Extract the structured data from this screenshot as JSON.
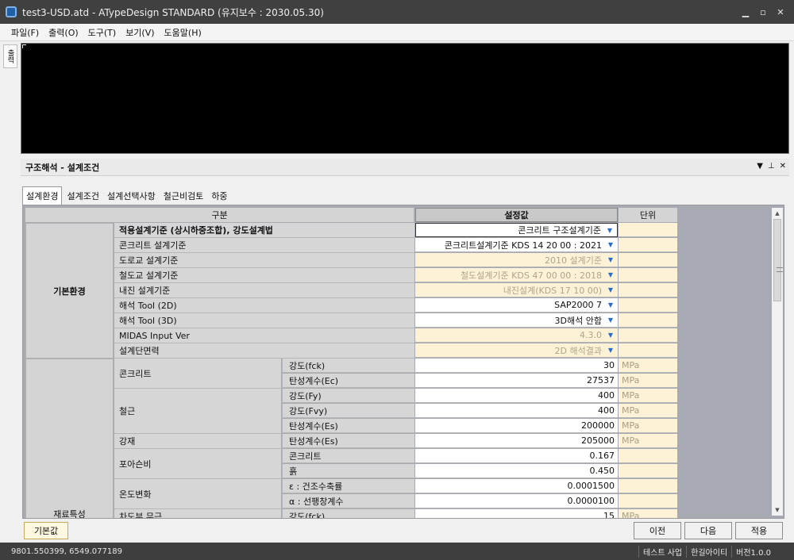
{
  "window": {
    "title": "test3-USD.atd - ATypeDesign STANDARD  (유지보수 : 2030.05.30)",
    "app_icon": "app-icon",
    "controls": [
      "minimize-icon",
      "maximize-icon",
      "close-icon"
    ]
  },
  "menu": [
    "파일(F)",
    "출력(O)",
    "도구(T)",
    "보기(V)",
    "도움말(H)"
  ],
  "side_tab": "출력",
  "panel": {
    "title": "구조해석 - 설계조건"
  },
  "tabs": [
    "설계환경",
    "설계조건",
    "설계선택사항",
    "철근비검토",
    "하중"
  ],
  "grid": {
    "headers": {
      "gubun": "구분",
      "value": "설정값",
      "unit": "단위"
    },
    "groups": [
      "기본환경",
      "재료특성"
    ],
    "rows": [
      {
        "label": "적용설계기준 (상시하중조합), 강도설계법",
        "value": "콘크리트 구조설계기준",
        "dropdown": true
      },
      {
        "label": "콘크리트 설계기준",
        "value": "콘크리트설계기준 KDS 14 20 00 : 2021",
        "dropdown": true
      },
      {
        "label": "도로교 설계기준",
        "value": "2010 설계기준",
        "dropdown": true,
        "disabled": true
      },
      {
        "label": "철도교 설계기준",
        "value": "철도설계기준 KDS 47 00 00 : 2018",
        "dropdown": true,
        "disabled": true
      },
      {
        "label": "내진 설계기준",
        "value": "내진설계(KDS 17 10 00)",
        "dropdown": true,
        "disabled": true
      },
      {
        "label": "해석 Tool (2D)",
        "value": "SAP2000 7",
        "dropdown": true
      },
      {
        "label": "해석 Tool (3D)",
        "value": "3D해석 안함",
        "dropdown": true
      },
      {
        "label": "MIDAS Input Ver",
        "value": "4.3.0",
        "dropdown": true,
        "disabled": true
      },
      {
        "label": "설계단면력",
        "value": "2D 해석결과",
        "dropdown": true,
        "disabled": true
      },
      {
        "label": "콘크리트",
        "sub": "강도(fck)",
        "value": "30",
        "unit": "MPa"
      },
      {
        "sub": "탄성계수(Ec)",
        "value": "27537",
        "unit": "MPa"
      },
      {
        "label": "철근",
        "sub": "강도(Fy)",
        "value": "400",
        "unit": "MPa"
      },
      {
        "sub": "강도(Fvy)",
        "value": "400",
        "unit": "MPa"
      },
      {
        "sub": "탄성계수(Es)",
        "value": "200000",
        "unit": "MPa"
      },
      {
        "label": "강재",
        "sub": "탄성계수(Es)",
        "value": "205000",
        "unit": "MPa"
      },
      {
        "label": "포아슨비",
        "sub": "콘크리트",
        "value": "0.167",
        "unit": ""
      },
      {
        "sub": "흙",
        "value": "0.450",
        "unit": ""
      },
      {
        "label": "온도변화",
        "sub": "ε : 건조수축률",
        "value": "0.0001500",
        "unit": ""
      },
      {
        "sub": "α : 선팽창계수",
        "value": "0.0000100",
        "unit": ""
      },
      {
        "label": "차도부 무근",
        "sub": "강도(fck)",
        "value": "15",
        "unit": "MPa"
      }
    ]
  },
  "buttons": {
    "default": "기본값",
    "prev": "이전",
    "next": "다음",
    "apply": "적용"
  },
  "status": {
    "coords": "9801.550399,    6549.077189",
    "items": [
      "테스트 사업",
      "한길아이티",
      "버전1.0.0"
    ]
  }
}
